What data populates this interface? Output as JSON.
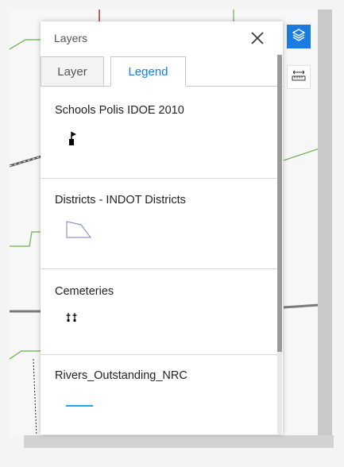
{
  "panel": {
    "title": "Layers",
    "tabs": [
      {
        "label": "Layer",
        "active": false
      },
      {
        "label": "Legend",
        "active": true
      }
    ]
  },
  "legend": {
    "items": [
      {
        "title": "Schools Polis IDOE 2010",
        "symbol": "school-flag-icon"
      },
      {
        "title": "Districts - INDOT Districts",
        "symbol": "polygon-icon"
      },
      {
        "title": "Cemeteries",
        "symbol": "cemetery-icon"
      },
      {
        "title": "Rivers_Outstanding_NRC",
        "symbol": "river-line-icon"
      }
    ]
  },
  "tools": {
    "layers_icon": "layers-icon",
    "measure_icon": "measure-icon"
  },
  "colors": {
    "accent": "#1b7be0",
    "river": "#1aa9e8",
    "polygon_stroke": "#6f86b5",
    "map_green": "#6ab04c",
    "map_red": "#b03030"
  }
}
